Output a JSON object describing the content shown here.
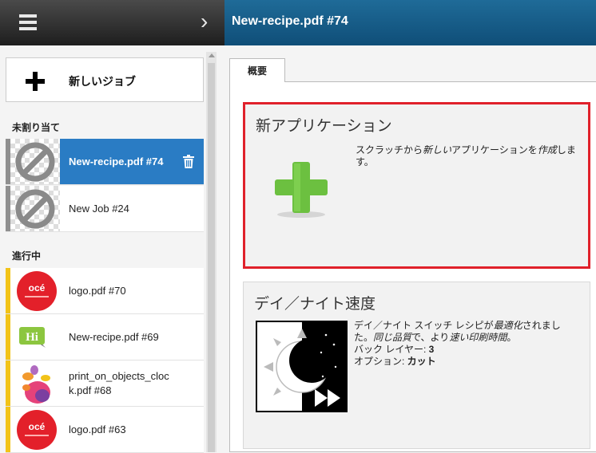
{
  "header": {
    "title": "New-recipe.pdf #74"
  },
  "sidebar": {
    "new_job_label": "新しいジョブ",
    "unassigned_label": "未割り当て",
    "in_progress_label": "進行中",
    "unassigned_jobs": [
      {
        "name": "New-recipe.pdf #74",
        "selected": true,
        "thumb": "no-preview-icon"
      },
      {
        "name": "New Job #24",
        "selected": false,
        "thumb": "no-preview-icon"
      }
    ],
    "in_progress_jobs": [
      {
        "name": "logo.pdf #70",
        "thumb": "oce-logo"
      },
      {
        "name": "New-recipe.pdf #69",
        "thumb": "hi-logo"
      },
      {
        "name": "print_on_objects_cloc",
        "name2": "k.pdf #68",
        "thumb": "butterfly-image"
      },
      {
        "name": "logo.pdf #63",
        "thumb": "oce-logo"
      }
    ],
    "oce_text": "océ",
    "hi_text": "Hi"
  },
  "tabs": {
    "overview": "概要"
  },
  "cards": {
    "new_app": {
      "title": "新アプリケーション",
      "desc_1": "スクラッチから",
      "desc_2": "新しい",
      "desc_3": "アプリケーションを",
      "desc_4": "作成",
      "desc_5": "しま",
      "desc_6": "す。"
    },
    "day_night": {
      "title": "デイ／ナイト速度",
      "desc_1": "デイ／ナイト スイッチ レシピが",
      "desc_2": "最適化",
      "desc_3": "されまし",
      "desc_4": "た。",
      "desc_5": "同じ品質",
      "desc_6": "で、より",
      "desc_7": "速い",
      "desc_8": "印刷時間",
      "desc_9": "。",
      "back_layer_label": "バック レイヤー: ",
      "back_layer_value": "3",
      "option_label": "オプション: ",
      "option_value": "カット"
    }
  },
  "colors": {
    "selected": "#2a7cc4",
    "in_progress_bar": "#f2c318",
    "unassigned_bar": "#8f8f8f",
    "highlight": "#e0212b",
    "plus_green": "#6cc040"
  }
}
